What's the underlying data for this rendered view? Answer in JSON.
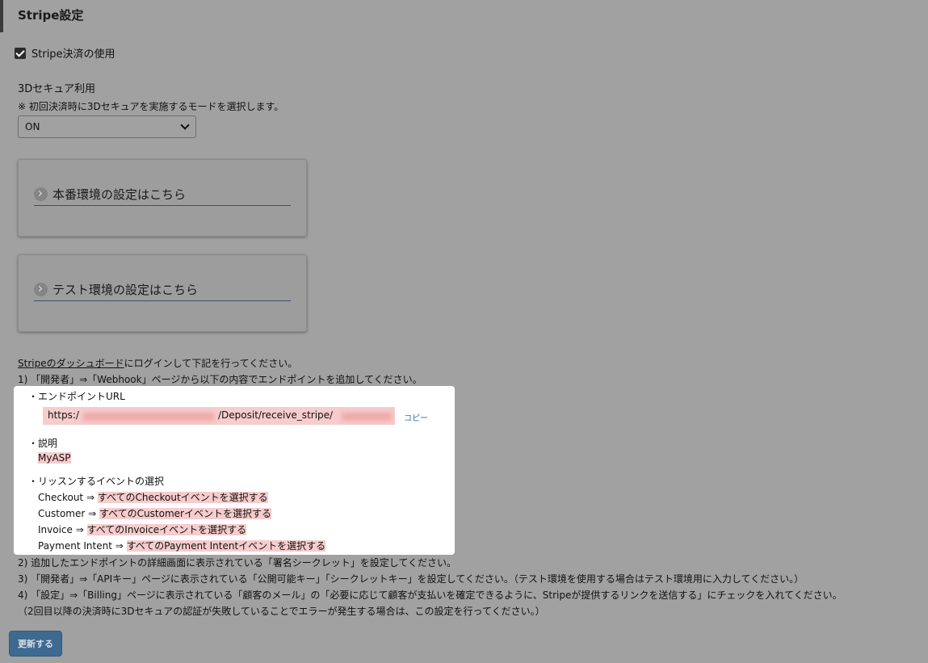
{
  "title": "Stripe設定",
  "use_stripe": {
    "label": "Stripe決済の使用",
    "checked": true
  },
  "secure3d": {
    "label": "3Dセキュア利用",
    "note": "※ 初回決済時に3Dセキュアを実施するモードを選択します。",
    "selected": "ON"
  },
  "cards": {
    "production": "本番環境の設定はこちら",
    "test": "テスト環境の設定はこちら"
  },
  "instructions": {
    "dashboard_link": "Stripeのダッシュボード",
    "intro_rest": "にログインして下記を行ってください。",
    "step1": "1) 「開発者」⇒「Webhook」ページから以下の内容でエンドポイントを追加してください。",
    "step2": "2) 追加したエンドポイントの詳細画面に表示されている「署名シークレット」を設定してください。",
    "step3": "3) 「開発者」⇒「APIキー」ページに表示されている「公開可能キー」「シークレットキー」を設定してください。（テスト環境を使用する場合はテスト環境用に入力してください。）",
    "step4": "4) 「設定」⇒「Billing」ページに表示されている「顧客のメール」の「必要に応じて顧客が支払いを確定できるように、Stripeが提供するリンクを送信する」にチェックを入れてください。",
    "step4_note": "（2回目以降の決済時に3Dセキュアの認証が失敗していることでエラーが発生する場合は、この設定を行ってください。）"
  },
  "popup": {
    "endpoint_label": "・エンドポイントURL",
    "url_prefix": "https:/",
    "url_path": "/Deposit/receive_stripe/",
    "copy_label": "コピー",
    "desc_label": "・説明",
    "desc_value": "MyASP",
    "events_label": "・リッスンするイベントの選択",
    "events": [
      {
        "name": "Checkout ⇒ ",
        "value": "すべてのCheckoutイベントを選択する"
      },
      {
        "name": "Customer ⇒ ",
        "value": "すべてのCustomerイベントを選択する"
      },
      {
        "name": "Invoice ⇒ ",
        "value": "すべてのInvoiceイベントを選択する"
      },
      {
        "name": "Payment Intent ⇒ ",
        "value": "すべてのPayment Intentイベントを選択する"
      }
    ]
  },
  "update_button": "更新する"
}
